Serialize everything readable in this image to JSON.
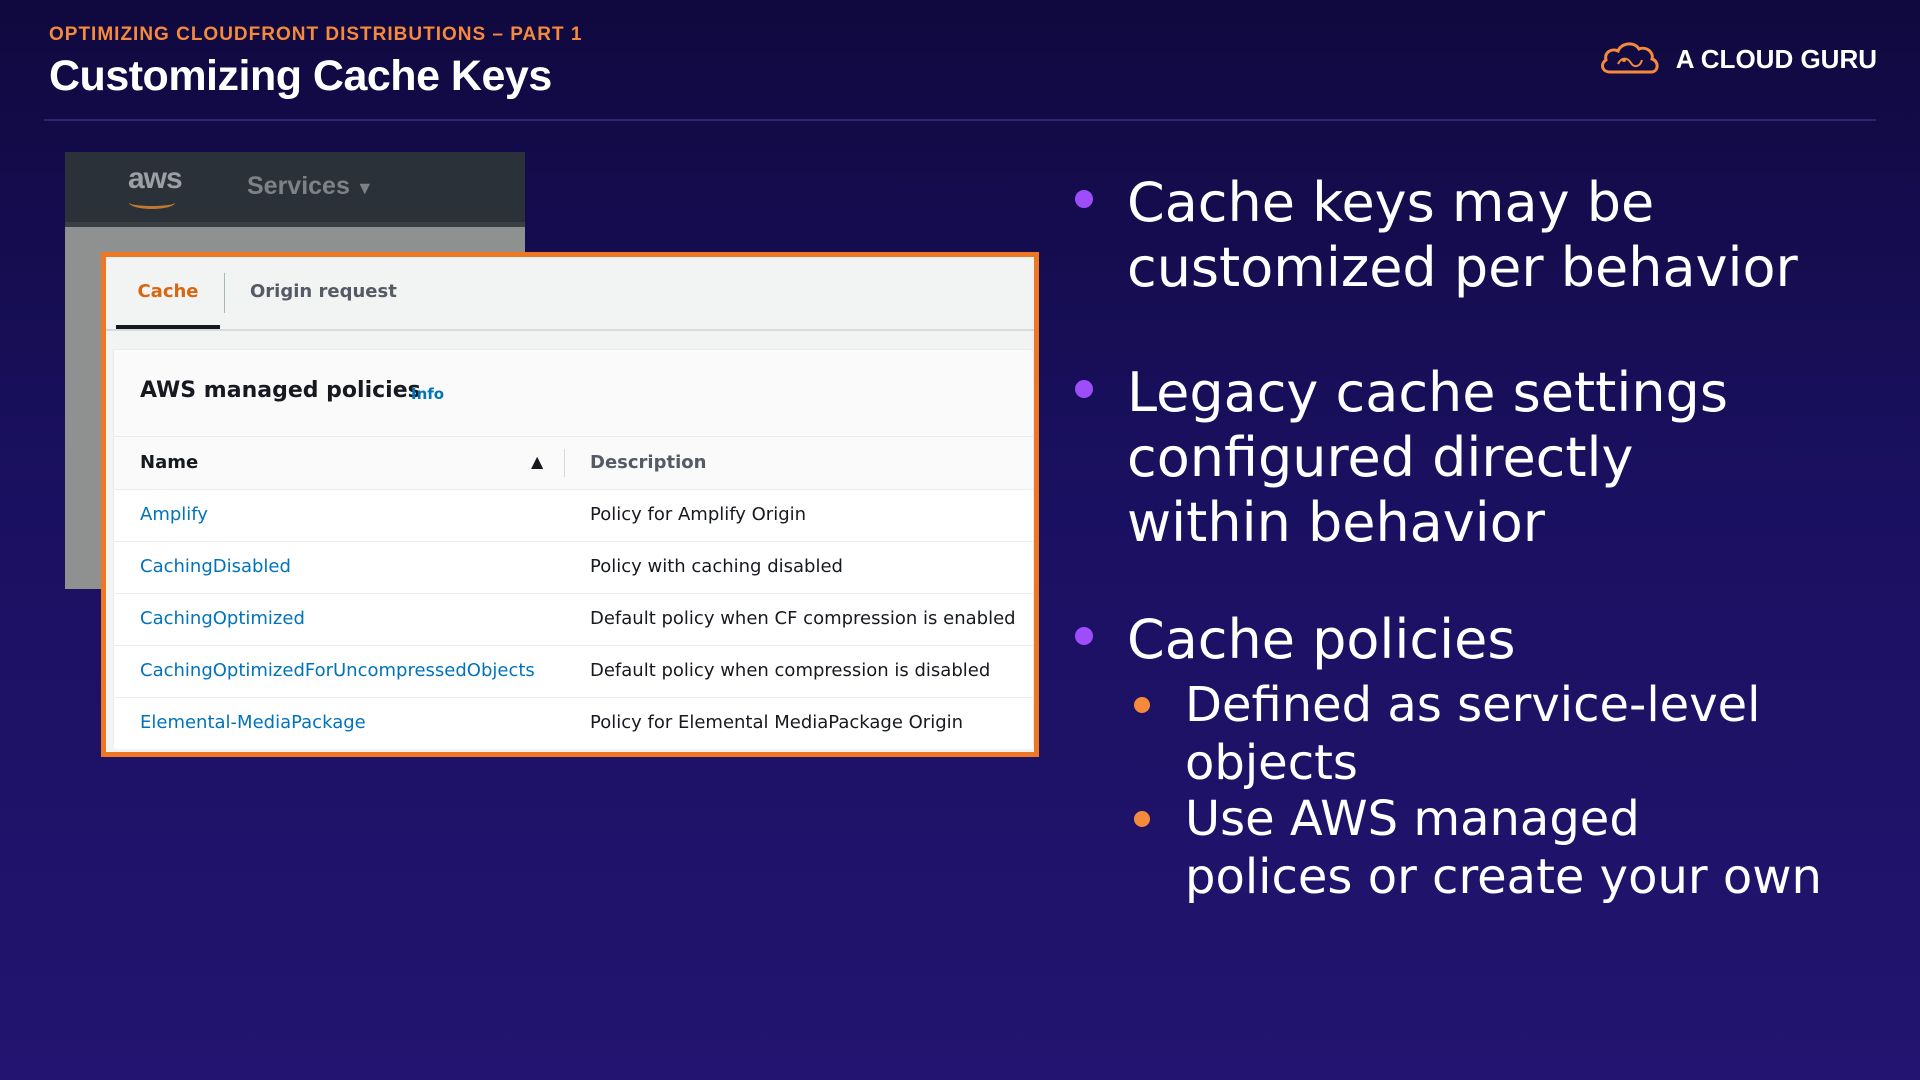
{
  "header": {
    "subtitle": "OPTIMIZING CLOUDFRONT DISTRIBUTIONS – PART 1",
    "title": "Customizing Cache Keys",
    "brand": "A CLOUD GURU"
  },
  "aws_console": {
    "logo": "aws",
    "services_label": "Services"
  },
  "policies_panel": {
    "tabs": [
      "Cache",
      "Origin request"
    ],
    "card_title": "AWS managed policies",
    "info_link": "Info",
    "columns": [
      "Name",
      "Description"
    ],
    "rows": [
      {
        "name": "Amplify",
        "description": "Policy for Amplify Origin"
      },
      {
        "name": "CachingDisabled",
        "description": "Policy with caching disabled"
      },
      {
        "name": "CachingOptimized",
        "description": "Default policy when CF compression is enabled"
      },
      {
        "name": "CachingOptimizedForUncompressedObjects",
        "description": "Default policy when compression is disabled"
      },
      {
        "name": "Elemental-MediaPackage",
        "description": "Policy for Elemental MediaPackage Origin"
      }
    ]
  },
  "bullets": {
    "b1_line1": "Cache keys may be",
    "b1_line2": "customized per behavior",
    "b2_line1": "Legacy cache settings",
    "b2_line2": "configured directly",
    "b2_line3": "within behavior",
    "b3": "Cache policies",
    "sub1_line1": "Defined as service-level",
    "sub1_line2": "objects",
    "sub2_line1": "Use AWS managed",
    "sub2_line2": "polices or create your own"
  },
  "colors": {
    "accent_orange": "#f58a3c",
    "bullet_purple": "#9d4dfa",
    "panel_border": "#ee7724",
    "link_blue": "#0073bb"
  }
}
